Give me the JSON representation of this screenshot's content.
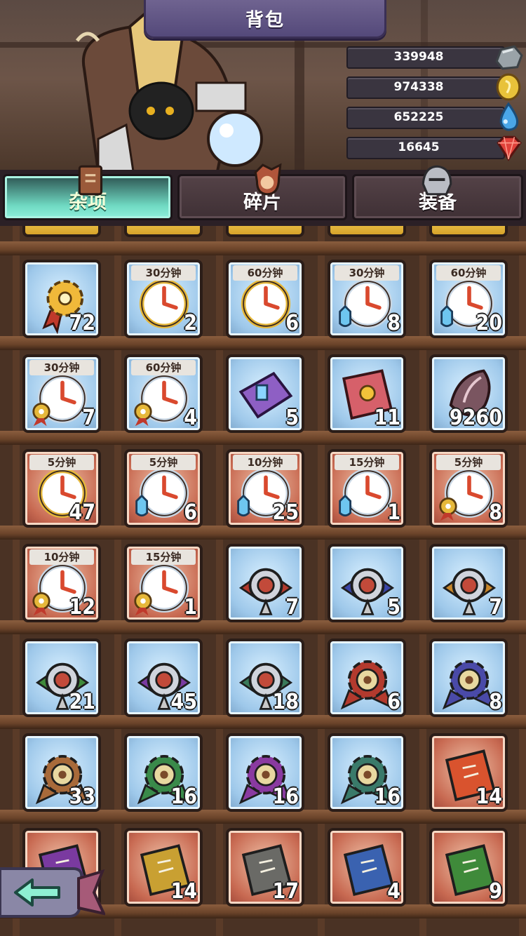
{
  "header": {
    "title": "背包"
  },
  "resources": [
    {
      "value": "339948",
      "icon": "stone-icon"
    },
    {
      "value": "974338",
      "icon": "gold-coin-icon"
    },
    {
      "value": "652225",
      "icon": "water-drop-icon"
    },
    {
      "value": "16645",
      "icon": "red-gem-icon"
    }
  ],
  "tabs": [
    {
      "label": "杂项",
      "active": true,
      "icon": "book-icon"
    },
    {
      "label": "碎片",
      "active": false,
      "icon": "hero-head-icon"
    },
    {
      "label": "装备",
      "active": false,
      "icon": "helmet-icon"
    }
  ],
  "grid": {
    "rows": [
      [
        {
          "kind": "gear-medal",
          "bg": "blue",
          "count": "72"
        },
        {
          "kind": "clock-gold",
          "bg": "blue",
          "tag": "30分钟",
          "count": "2"
        },
        {
          "kind": "clock-gold",
          "bg": "blue",
          "tag": "60分钟",
          "count": "6"
        },
        {
          "kind": "clock-potion",
          "bg": "blue",
          "tag": "30分钟",
          "count": "8"
        },
        {
          "kind": "clock-potion",
          "bg": "blue",
          "tag": "60分钟",
          "count": "20"
        }
      ],
      [
        {
          "kind": "clock-gear",
          "bg": "blue",
          "tag": "30分钟",
          "count": "7"
        },
        {
          "kind": "clock-gear",
          "bg": "blue",
          "tag": "60分钟",
          "count": "4"
        },
        {
          "kind": "purple-book",
          "bg": "blue",
          "count": "5"
        },
        {
          "kind": "red-book",
          "bg": "blue",
          "count": "11"
        },
        {
          "kind": "crystal",
          "bg": "blue",
          "count": "9260"
        }
      ],
      [
        {
          "kind": "clock-gold",
          "bg": "red",
          "tag": "5分钟",
          "count": "47"
        },
        {
          "kind": "clock-potion",
          "bg": "red",
          "tag": "5分钟",
          "count": "6"
        },
        {
          "kind": "clock-potion",
          "bg": "red",
          "tag": "10分钟",
          "count": "25"
        },
        {
          "kind": "clock-potion",
          "bg": "red",
          "tag": "15分钟",
          "count": "1"
        },
        {
          "kind": "clock-gear",
          "bg": "red",
          "tag": "5分钟",
          "count": "8"
        }
      ],
      [
        {
          "kind": "clock-gear",
          "bg": "red",
          "tag": "10分钟",
          "count": "12"
        },
        {
          "kind": "clock-gear",
          "bg": "red",
          "tag": "15分钟",
          "count": "1"
        },
        {
          "kind": "eye-emblem",
          "bg": "blue",
          "count": "7",
          "color": "#b33a2e"
        },
        {
          "kind": "eye-emblem",
          "bg": "blue",
          "count": "5",
          "color": "#3a45a8"
        },
        {
          "kind": "eye-emblem",
          "bg": "blue",
          "count": "7",
          "color": "#c8862a"
        }
      ],
      [
        {
          "kind": "eye-emblem",
          "bg": "blue",
          "count": "21",
          "color": "#3f8a3a"
        },
        {
          "kind": "eye-emblem",
          "bg": "blue",
          "count": "45",
          "color": "#7a3aa0"
        },
        {
          "kind": "eye-emblem",
          "bg": "blue",
          "count": "18",
          "color": "#3a7a5a"
        },
        {
          "kind": "gear-emblem",
          "bg": "blue",
          "count": "6",
          "color": "#b33a2e"
        },
        {
          "kind": "gear-emblem",
          "bg": "blue",
          "count": "8",
          "color": "#4a4aa8"
        }
      ],
      [
        {
          "kind": "gear-emblem",
          "bg": "blue",
          "count": "33",
          "color": "#a86a3a"
        },
        {
          "kind": "gear-emblem",
          "bg": "blue",
          "count": "16",
          "color": "#3a8a4a"
        },
        {
          "kind": "gear-emblem",
          "bg": "blue",
          "count": "16",
          "color": "#8a3aa0"
        },
        {
          "kind": "gear-emblem",
          "bg": "blue",
          "count": "16",
          "color": "#3a7a6a"
        },
        {
          "kind": "scroll-book",
          "bg": "red",
          "count": "14",
          "color": "#d9532e"
        }
      ],
      [
        {
          "kind": "scroll-book",
          "bg": "red",
          "count": "",
          "color": "#7a3aa0"
        },
        {
          "kind": "scroll-book",
          "bg": "red",
          "count": "14",
          "color": "#c9a032"
        },
        {
          "kind": "scroll-book",
          "bg": "red",
          "count": "17",
          "color": "#6a6a66"
        },
        {
          "kind": "scroll-book",
          "bg": "red",
          "count": "4",
          "color": "#3a62b0"
        },
        {
          "kind": "scroll-book",
          "bg": "red",
          "count": "9",
          "color": "#3f8a3a"
        }
      ]
    ]
  },
  "back_button": {
    "icon": "back-arrow-icon"
  }
}
